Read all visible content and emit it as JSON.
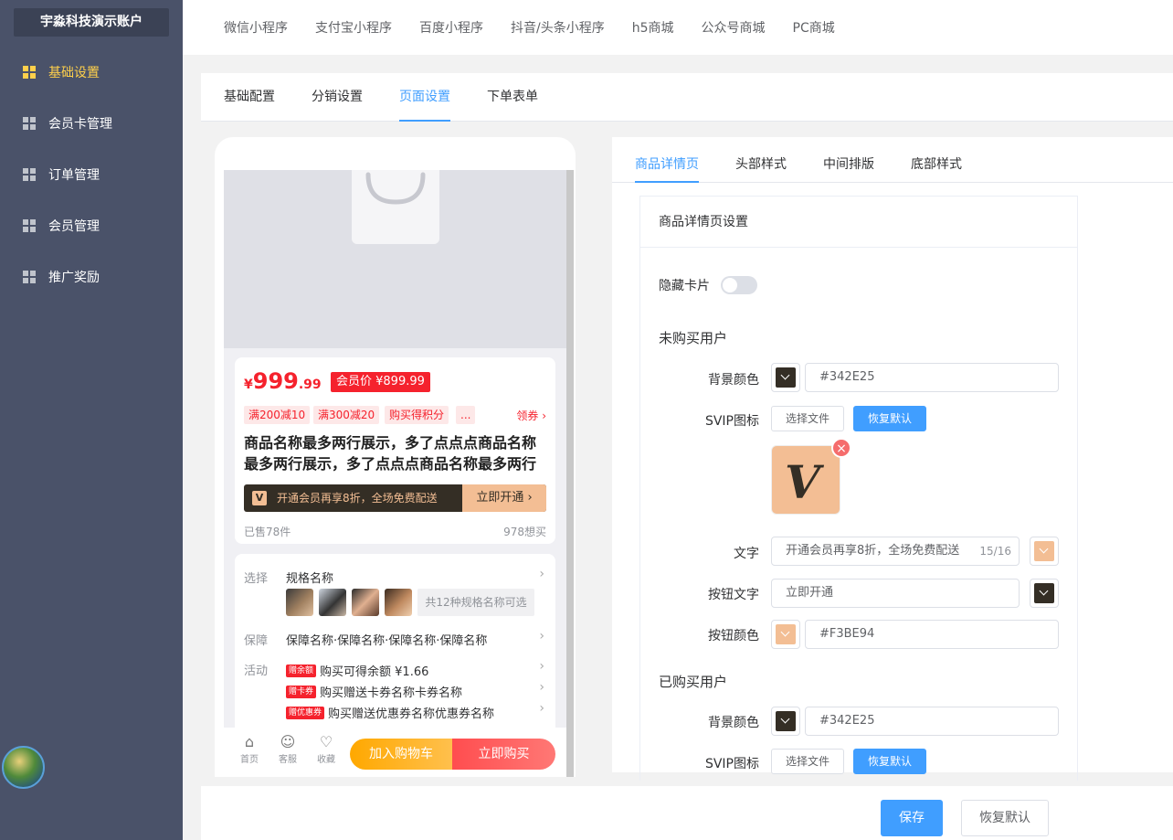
{
  "sidebar": {
    "account": "宇淼科技演示账户",
    "items": [
      {
        "label": "基础设置"
      },
      {
        "label": "会员卡管理"
      },
      {
        "label": "订单管理"
      },
      {
        "label": "会员管理"
      },
      {
        "label": "推广奖励"
      }
    ]
  },
  "platform_tabs": [
    "微信小程序",
    "支付宝小程序",
    "百度小程序",
    "抖音/头条小程序",
    "h5商城",
    "公众号商城",
    "PC商城"
  ],
  "sub_tabs": [
    "基础配置",
    "分销设置",
    "页面设置",
    "下单表单"
  ],
  "preview": {
    "currency": "¥",
    "price_int": "999",
    "price_dec": ".99",
    "member_price": "会员价 ¥899.99",
    "tags": [
      "满200减10",
      "满300减20",
      "购买得积分",
      "..."
    ],
    "coupon": "领券",
    "title": "商品名称最多两行展示，多了点点点商品名称最多两行展示，多了点点点商品名称最多两行展示",
    "vip_bar_text": "开通会员再享8折，全场免费配送",
    "vip_icon": "V",
    "vip_button": "立即开通",
    "sold": "已售78件",
    "want": "978想买",
    "select_label": "选择",
    "spec_name": "规格名称",
    "spec_all": "共12种规格名称可选",
    "guarantee_label": "保障",
    "guarantee_value": "保障名称·保障名称·保障名称·保障名称",
    "activity_label": "活动",
    "activities": [
      {
        "tag": "赠余额",
        "text": "购买可得余额 ¥1.66"
      },
      {
        "tag": "赠卡券",
        "text": "购买赠送卡券名称卡券名称"
      },
      {
        "tag": "赠优惠券",
        "text": "购买赠送优惠券名称优惠券名称"
      }
    ],
    "bottom_icons": [
      "首页",
      "客服",
      "收藏"
    ],
    "add_cart": "加入购物车",
    "buy_now": "立即购买"
  },
  "panel": {
    "tabs": [
      "商品详情页",
      "头部样式",
      "中间排版",
      "底部样式"
    ],
    "box_title": "商品详情页设置",
    "hide_card_label": "隐藏卡片",
    "section_unpurchased": "未购买用户",
    "section_purchased": "已购买用户",
    "bg_color_label": "背景颜色",
    "bg_color_value": "#342E25",
    "svip_label": "SVIP图标",
    "choose_file": "选择文件",
    "restore_default": "恢复默认",
    "svip_image_letter": "V",
    "text_label": "文字",
    "text_value": "开通会员再享8折，全场免费配送",
    "text_count": "15/16",
    "button_text_label": "按钮文字",
    "button_text_value": "立即开通",
    "button_color_label": "按钮颜色",
    "button_color_value": "#F3BE94",
    "bg_color2_value": "#342E25"
  },
  "footer": {
    "save": "保存",
    "reset": "恢复默认"
  },
  "colors": {
    "dark": "#342e25",
    "gold": "#f3be94",
    "primary": "#409eff",
    "red": "#f5222d"
  }
}
